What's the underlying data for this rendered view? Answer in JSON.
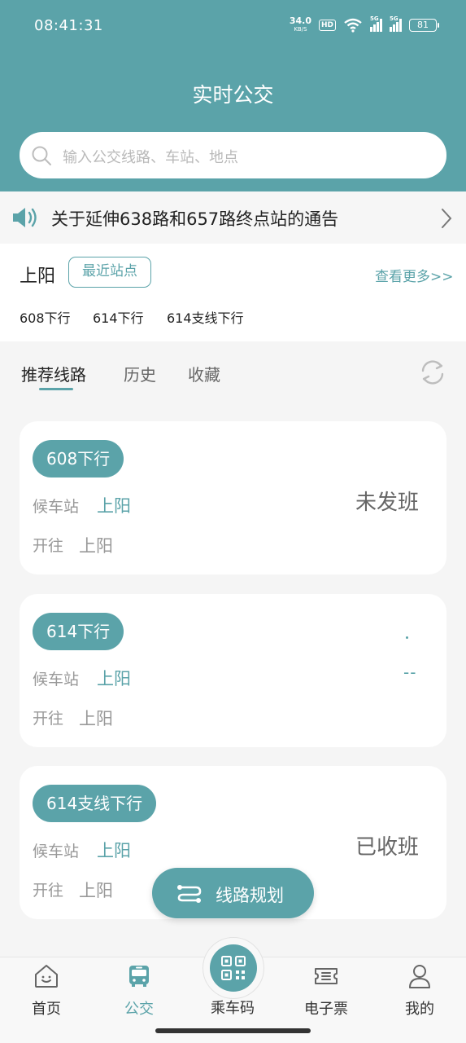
{
  "status_bar": {
    "time": "08:41:31",
    "net_speed": "34.0",
    "net_unit": "KB/S",
    "hd": "HD",
    "signal1": "5G",
    "signal2": "5G",
    "battery": "81"
  },
  "header": {
    "title": "实时公交",
    "search_placeholder": "输入公交线路、车站、地点"
  },
  "notice": {
    "text": "关于延伸638路和657路终点站的通告"
  },
  "nearby": {
    "station": "上阳",
    "nearest_label": "最近站点",
    "more_label": "查看更多>>",
    "lines": [
      "608下行",
      "614下行",
      "614支线下行"
    ]
  },
  "tabs": {
    "items": [
      {
        "label": "推荐线路"
      },
      {
        "label": "历史"
      },
      {
        "label": "收藏"
      }
    ]
  },
  "routes": [
    {
      "name": "608下行",
      "wait_label": "候车站",
      "wait_station": "上阳",
      "to_label": "开往",
      "to_station": "上阳",
      "status": "未发班"
    },
    {
      "name": "614下行",
      "wait_label": "候车站",
      "wait_station": "上阳",
      "to_label": "开往",
      "to_station": "上阳",
      "status": "--"
    },
    {
      "name": "614支线下行",
      "wait_label": "候车站",
      "wait_station": "上阳",
      "to_label": "开往",
      "to_station": "上阳",
      "status": "已收班"
    }
  ],
  "plan_button": {
    "label": "线路规划"
  },
  "tabbar": {
    "items": [
      {
        "label": "首页",
        "icon": "home-icon"
      },
      {
        "label": "公交",
        "icon": "bus-icon"
      },
      {
        "label": "乘车码",
        "icon": "qr-code-icon"
      },
      {
        "label": "电子票",
        "icon": "ticket-icon"
      },
      {
        "label": "我的",
        "icon": "user-icon"
      }
    ]
  },
  "colors": {
    "accent": "#5ba3a9"
  }
}
